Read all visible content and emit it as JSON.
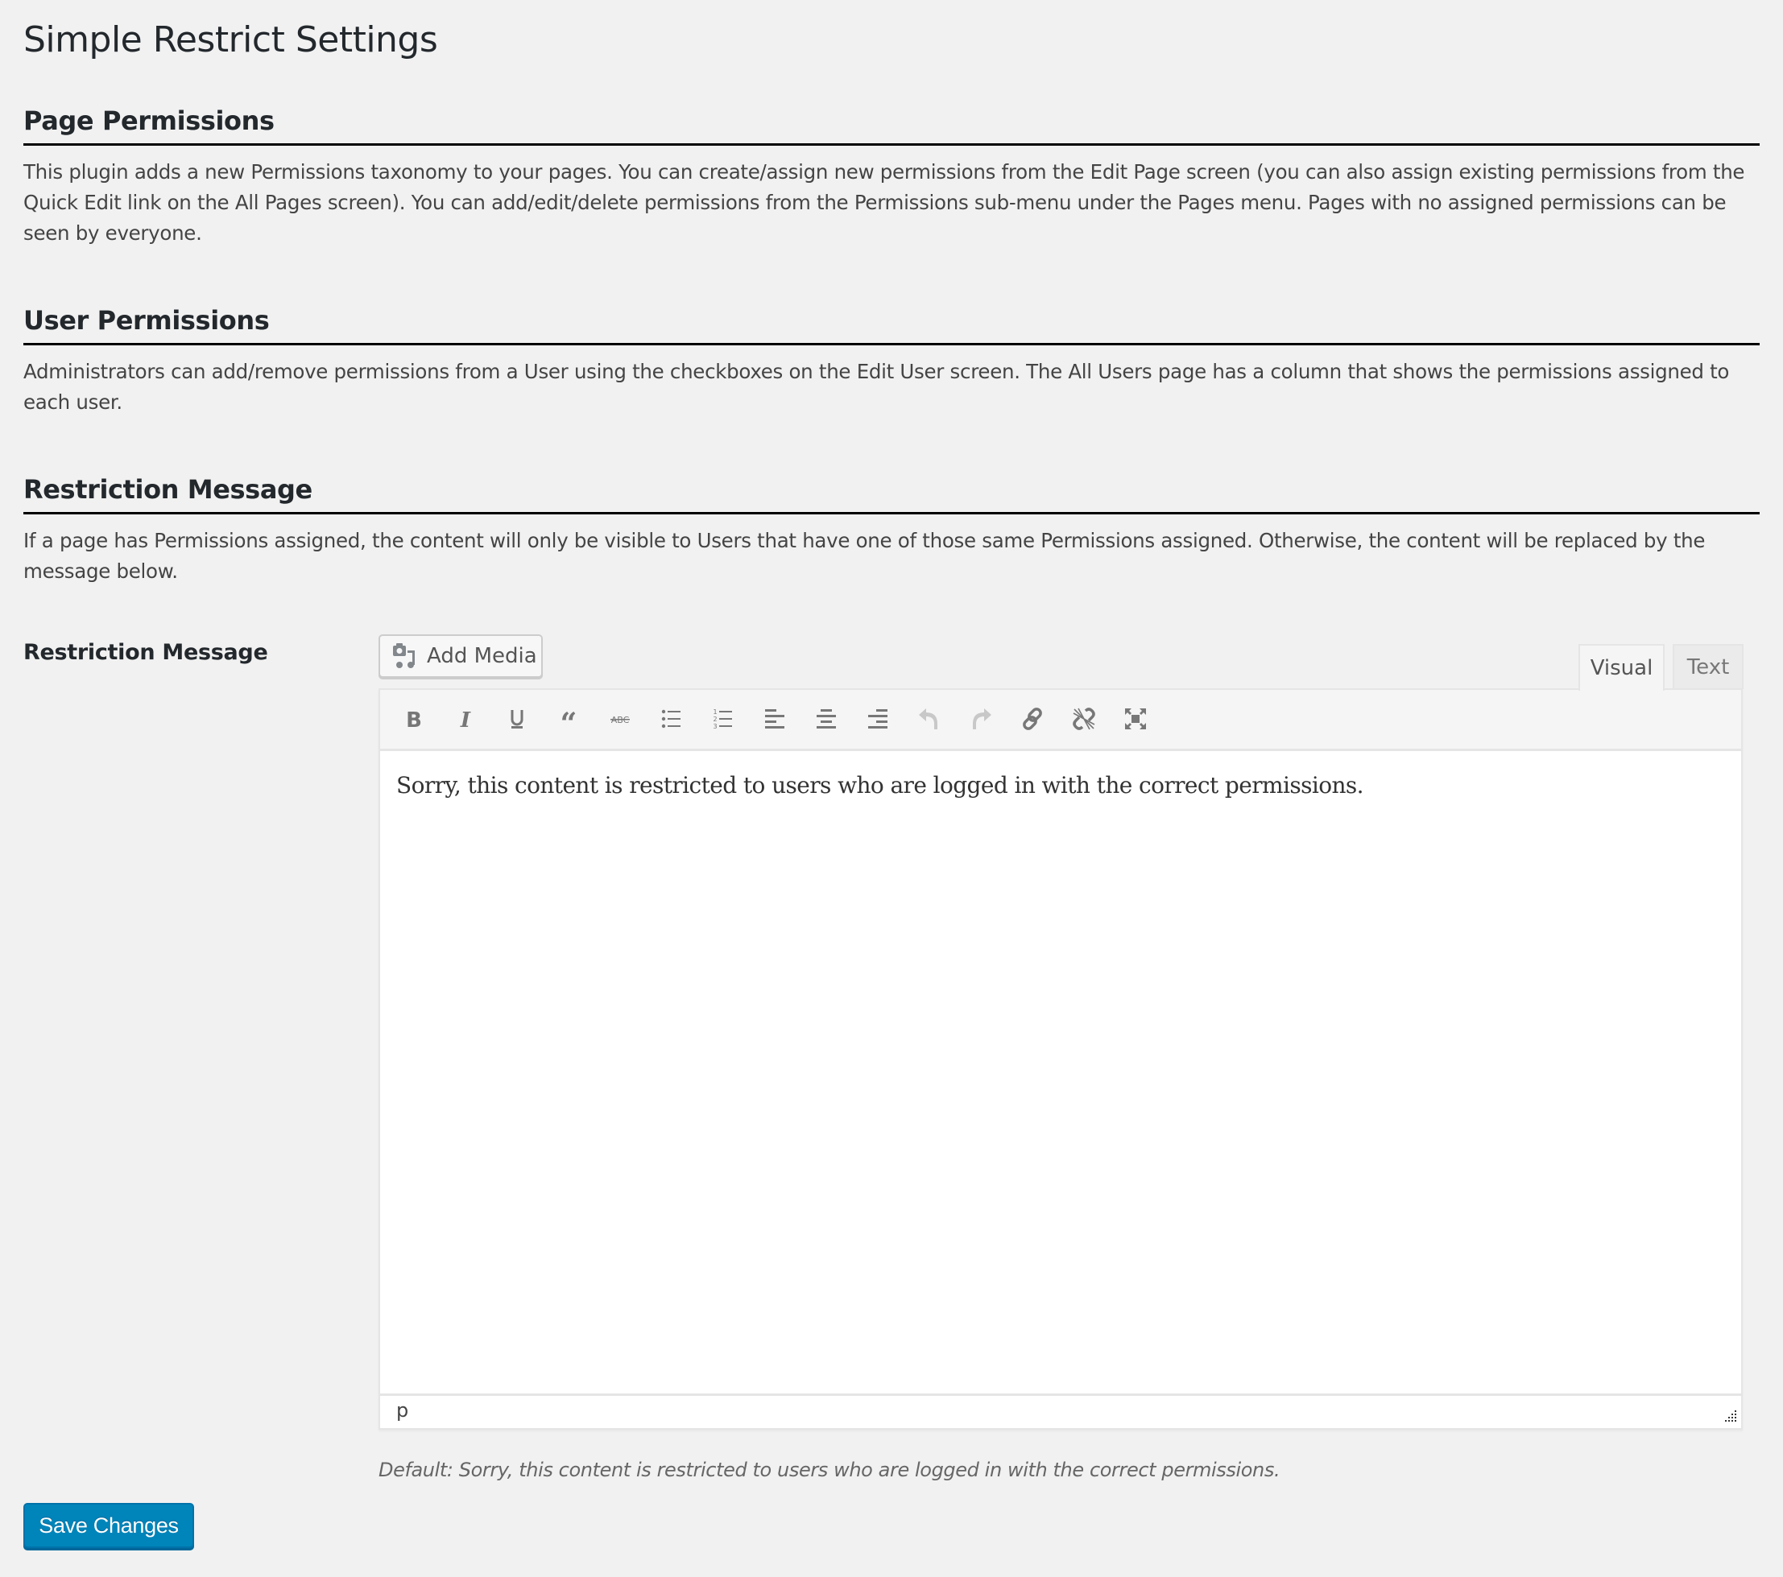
{
  "page": {
    "title": "Simple Restrict Settings"
  },
  "sections": [
    {
      "heading": "Page Permissions",
      "text": "This plugin adds a new Permissions taxonomy to your pages. You can create/assign new permissions from the Edit Page screen (you can also assign existing permissions from the Quick Edit link on the All Pages screen). You can add/edit/delete permissions from the Permissions sub-menu under the Pages menu. Pages with no assigned permissions can be seen by everyone."
    },
    {
      "heading": "User Permissions",
      "text": "Administrators can add/remove permissions from a User using the checkboxes on the Edit User screen. The All Users page has a column that shows the permissions assigned to each user."
    },
    {
      "heading": "Restriction Message",
      "text": "If a page has Permissions assigned, the content will only be visible to Users that have one of those same Permissions assigned. Otherwise, the content will be replaced by the message below."
    }
  ],
  "field": {
    "label": "Restriction Message",
    "add_media_label": "Add Media",
    "tabs": {
      "visual": "Visual",
      "text": "Text",
      "active": "visual"
    },
    "toolbar": [
      {
        "name": "bold",
        "icon": "bold-icon",
        "enabled": true
      },
      {
        "name": "italic",
        "icon": "italic-icon",
        "enabled": true
      },
      {
        "name": "underline",
        "icon": "underline-icon",
        "enabled": true
      },
      {
        "name": "blockquote",
        "icon": "blockquote-icon",
        "enabled": true
      },
      {
        "name": "strikethrough",
        "icon": "strikethrough-icon",
        "enabled": true
      },
      {
        "name": "bulleted-list",
        "icon": "bulleted-list-icon",
        "enabled": true
      },
      {
        "name": "numbered-list",
        "icon": "numbered-list-icon",
        "enabled": true
      },
      {
        "name": "align-left",
        "icon": "align-left-icon",
        "enabled": true
      },
      {
        "name": "align-center",
        "icon": "align-center-icon",
        "enabled": true
      },
      {
        "name": "align-right",
        "icon": "align-right-icon",
        "enabled": true
      },
      {
        "name": "undo",
        "icon": "undo-icon",
        "enabled": false
      },
      {
        "name": "redo",
        "icon": "redo-icon",
        "enabled": false
      },
      {
        "name": "insert-link",
        "icon": "link-icon",
        "enabled": true
      },
      {
        "name": "remove-link",
        "icon": "unlink-icon",
        "enabled": true
      },
      {
        "name": "fullscreen",
        "icon": "fullscreen-icon",
        "enabled": true
      }
    ],
    "content": "Sorry, this content is restricted to users who are logged in with the correct permissions.",
    "element_path": "p",
    "default_hint": "Default: Sorry, this content is restricted to users who are logged in with the correct permissions."
  },
  "actions": {
    "save_label": "Save Changes"
  },
  "colors": {
    "primary": "#0085ba",
    "background": "#f1f1f1",
    "icon": "#777777",
    "icon_disabled": "#c8c8c8"
  }
}
